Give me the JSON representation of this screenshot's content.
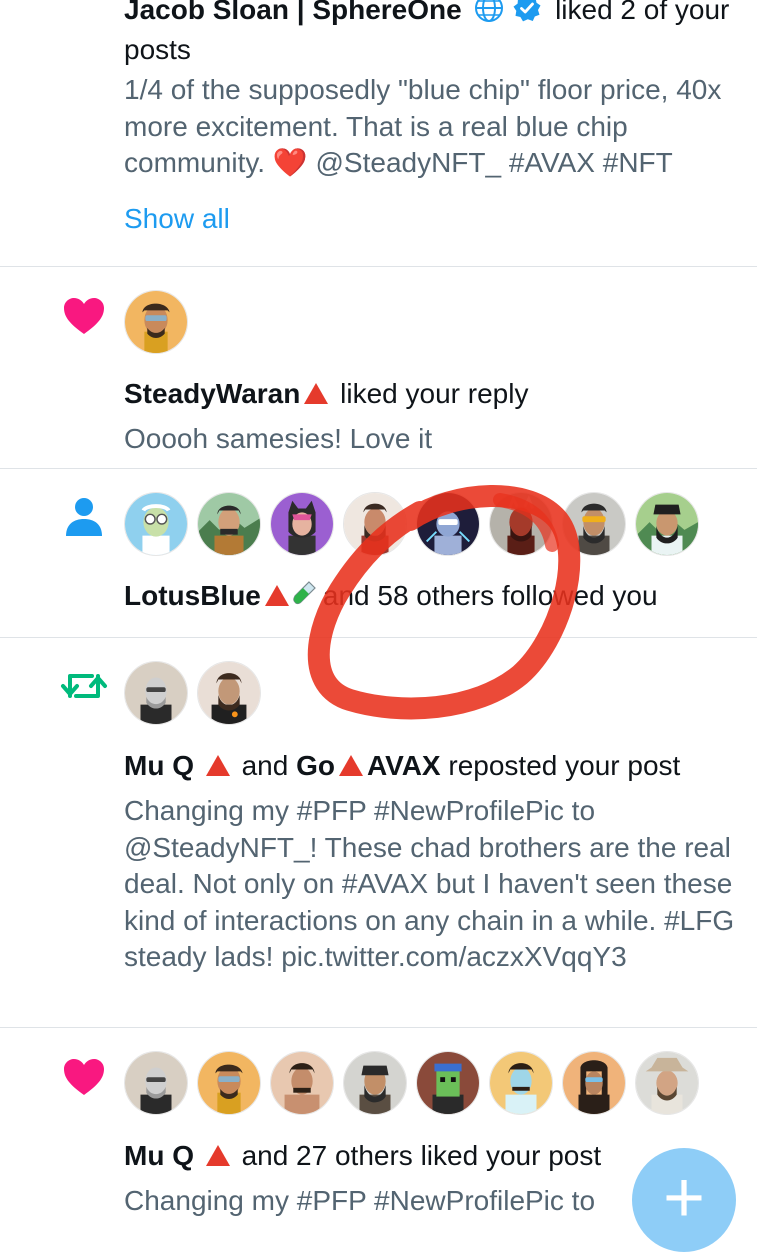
{
  "notifications": [
    {
      "type": "like",
      "user": "Jacob Sloan | SphereOne",
      "action": "liked 2 of your",
      "action_cont": "posts",
      "body": "1/4 of the supposedly \"blue chip\" floor price, 40x more excitement. That is a real blue chip community. ❤️ @SteadyNFT_ #AVAX #NFT",
      "show_all": "Show all"
    },
    {
      "type": "like",
      "icon": "heart-icon",
      "user": "SteadyWaran",
      "action": "liked your reply",
      "body": "Ooooh samesies! Love it"
    },
    {
      "type": "follow",
      "icon": "person-icon",
      "user": "LotusBlue",
      "action": "and 58 others followed you"
    },
    {
      "type": "repost",
      "icon": "repost-icon",
      "user1": "Mu Q",
      "and": "and",
      "user2": "Go",
      "user2_suffix": "AVAX",
      "action": "reposted your post",
      "body": "Changing my #PFP #NewProfilePic to @SteadyNFT_! These chad brothers are the real deal. Not only on #AVAX but I haven't seen these kind of interactions on any chain in a while. #LFG steady lads! pic.twitter.com/aczxXVqqY3"
    },
    {
      "type": "like",
      "icon": "heart-icon",
      "user": "Mu Q",
      "action": "and 27 others liked your post",
      "body": "Changing my #PFP #NewProfilePic to"
    }
  ],
  "fab": {
    "label": "+"
  },
  "colors": {
    "like": "#f91880",
    "follow": "#1d9bf0",
    "repost": "#00ba7c",
    "link": "#1d9bf0",
    "secondary_text": "#536471",
    "scribble": "#e8311d"
  }
}
